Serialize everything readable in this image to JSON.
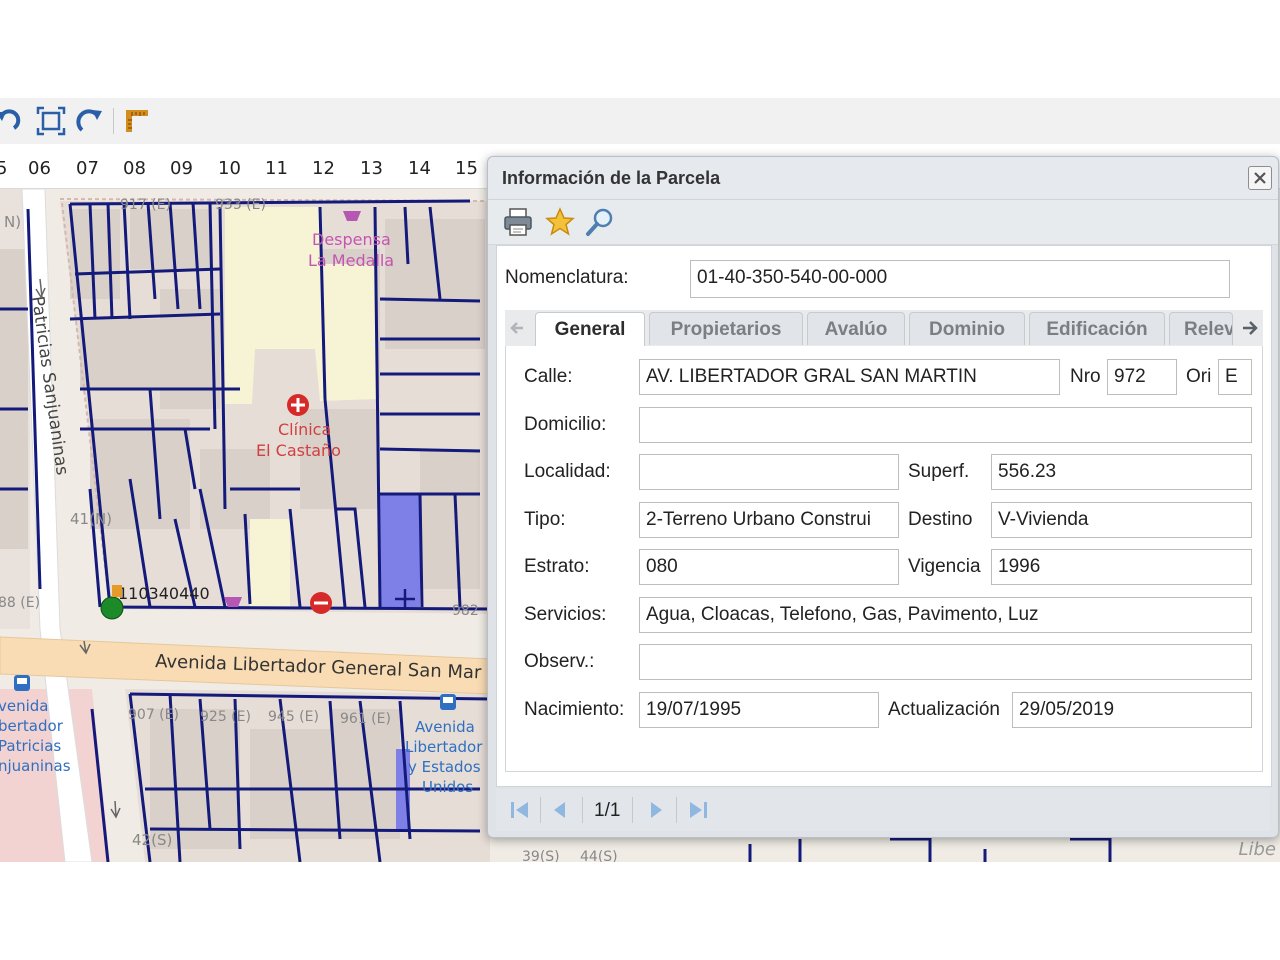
{
  "ruler": {
    "numbers": [
      "5",
      "06",
      "07",
      "08",
      "09",
      "10",
      "11",
      "12",
      "13",
      "14",
      "15"
    ]
  },
  "map": {
    "labels": {
      "despensa_line1": "Despensa",
      "despensa_line2": "La Medalla",
      "clinica_line1": "Clínica",
      "clinica_line2": "El Castaño",
      "street_vertical": "Patricias Sanjuaninas",
      "avenue": "Avenida Libertador General San Mar",
      "block_41n": "41(N)",
      "block_42s": "42(S)",
      "parcel_code": "110340440",
      "stop_left_1": "venida",
      "stop_left_2": "bertador",
      "stop_left_3": "Patricias",
      "stop_left_4": "njuaninas",
      "stop_right_1": "Avenida",
      "stop_right_2": "Libertador",
      "stop_right_3": "y Estados",
      "stop_right_4": "Unidos",
      "top_left_code": "N)",
      "top_code_1": "917 (E)",
      "top_code_2": "933 (E)",
      "left_code": "88 (E)",
      "bottom_code_1": "907 (E)",
      "bottom_code_2": "925 (E)",
      "bottom_code_3": "945 (E)",
      "bottom_code_4": "961 (E)",
      "right_code": "982",
      "bottom_right_1": "39(S)",
      "bottom_right_2": "44(S)"
    },
    "attribution": "Libe",
    "colors": {
      "parcel_line": "#141a7a",
      "building": "#d9d0c9",
      "road": "#ffffff",
      "avenue": "#f9dcb4",
      "highlight": "#7f7fe8",
      "hospital": "#d62a2a",
      "plaza": "#f7f3d5"
    }
  },
  "dialog": {
    "title": "Información de la Parcela",
    "tools": [
      "printer-icon",
      "star-icon",
      "magnifier-icon"
    ],
    "nomenclatura_label": "Nomenclatura:",
    "nomenclatura_value": "01-40-350-540-00-000",
    "tabs": [
      "General",
      "Propietarios",
      "Avalúo",
      "Dominio",
      "Edificación",
      "Relev"
    ],
    "active_tab": "General",
    "general": {
      "calle_label": "Calle:",
      "calle_value": "AV. LIBERTADOR GRAL SAN MARTIN",
      "nro_label": "Nro",
      "nro_value": "972",
      "ori_label": "Ori",
      "ori_value": "E",
      "domicilio_label": "Domicilio:",
      "domicilio_value": "",
      "localidad_label": "Localidad:",
      "localidad_value": "",
      "superf_label": "Superf.",
      "superf_value": "556.23",
      "tipo_label": "Tipo:",
      "tipo_value": "2-Terreno Urbano Construi",
      "destino_label": "Destino",
      "destino_value": "V-Vivienda",
      "estrato_label": "Estrato:",
      "estrato_value": "080",
      "vigencia_label": "Vigencia",
      "vigencia_value": "1996",
      "servicios_label": "Servicios:",
      "servicios_value": "Agua, Cloacas, Telefono, Gas, Pavimento, Luz",
      "observ_label": "Observ.:",
      "observ_value": "",
      "nacimiento_label": "Nacimiento:",
      "nacimiento_value": "19/07/1995",
      "actualizacion_label": "Actualización",
      "actualizacion_value": "29/05/2019"
    },
    "pager": {
      "text": "1/1"
    }
  }
}
